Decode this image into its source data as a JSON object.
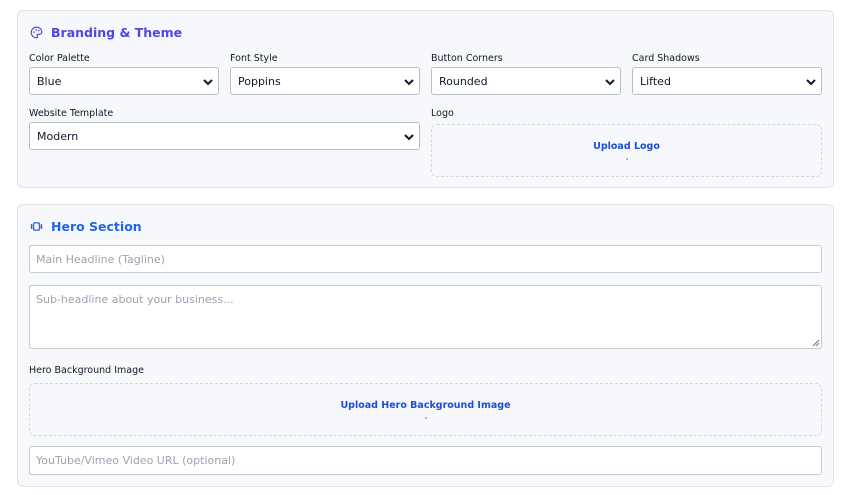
{
  "branding": {
    "title": "Branding & Theme",
    "icon": "palette-icon",
    "color_palette": {
      "label": "Color Palette",
      "value": "Blue"
    },
    "font_style": {
      "label": "Font Style",
      "value": "Poppins"
    },
    "button_corners": {
      "label": "Button Corners",
      "value": "Rounded"
    },
    "card_shadows": {
      "label": "Card Shadows",
      "value": "Lifted"
    },
    "website_template": {
      "label": "Website Template",
      "value": "Modern"
    },
    "logo": {
      "label": "Logo",
      "upload_text": "Upload Logo"
    }
  },
  "hero": {
    "title": "Hero Section",
    "icon": "hero-icon",
    "headline_placeholder": "Main Headline (Tagline)",
    "subheadline_placeholder": "Sub-headline about your business...",
    "background": {
      "label": "Hero Background Image",
      "upload_text": "Upload Hero Background Image"
    },
    "video_placeholder": "YouTube/Vimeo Video URL (optional)"
  },
  "colors": {
    "branding_accent": "#4f46e5",
    "hero_accent": "#2563eb",
    "upload_link": "#1d4ed8"
  }
}
